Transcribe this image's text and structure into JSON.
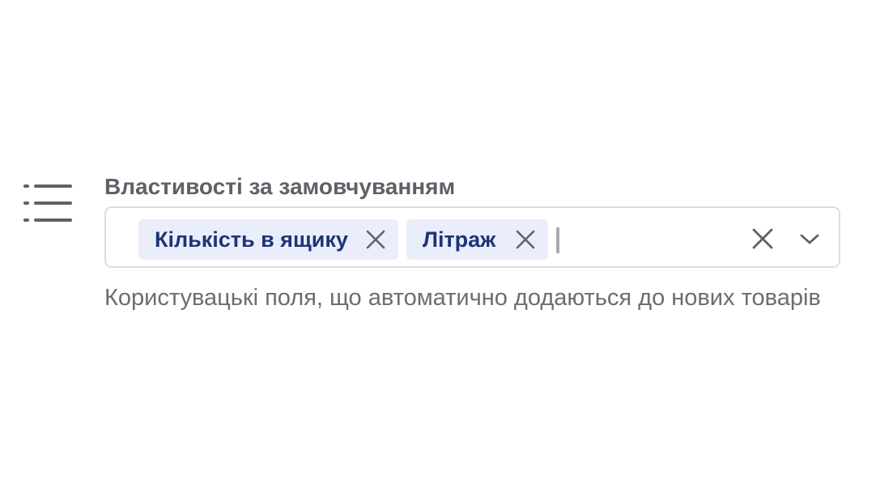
{
  "field": {
    "icon": "list-icon",
    "label": "Властивості за замовчуванням",
    "selected_tags": [
      {
        "label": "Кількість в ящику",
        "remove_icon": "close-icon"
      },
      {
        "label": "Літраж",
        "remove_icon": "close-icon"
      }
    ],
    "input_value": "",
    "clear_icon": "close-icon",
    "dropdown_icon": "chevron-down-icon",
    "help_text": "Користувацькі поля, що автоматично додаються до нових товарів"
  },
  "colors": {
    "label": "#5f6168",
    "tag_background": "#e9eefa",
    "tag_text": "#1f3378",
    "border": "#dcdde0",
    "help_text": "#6b6d73"
  }
}
